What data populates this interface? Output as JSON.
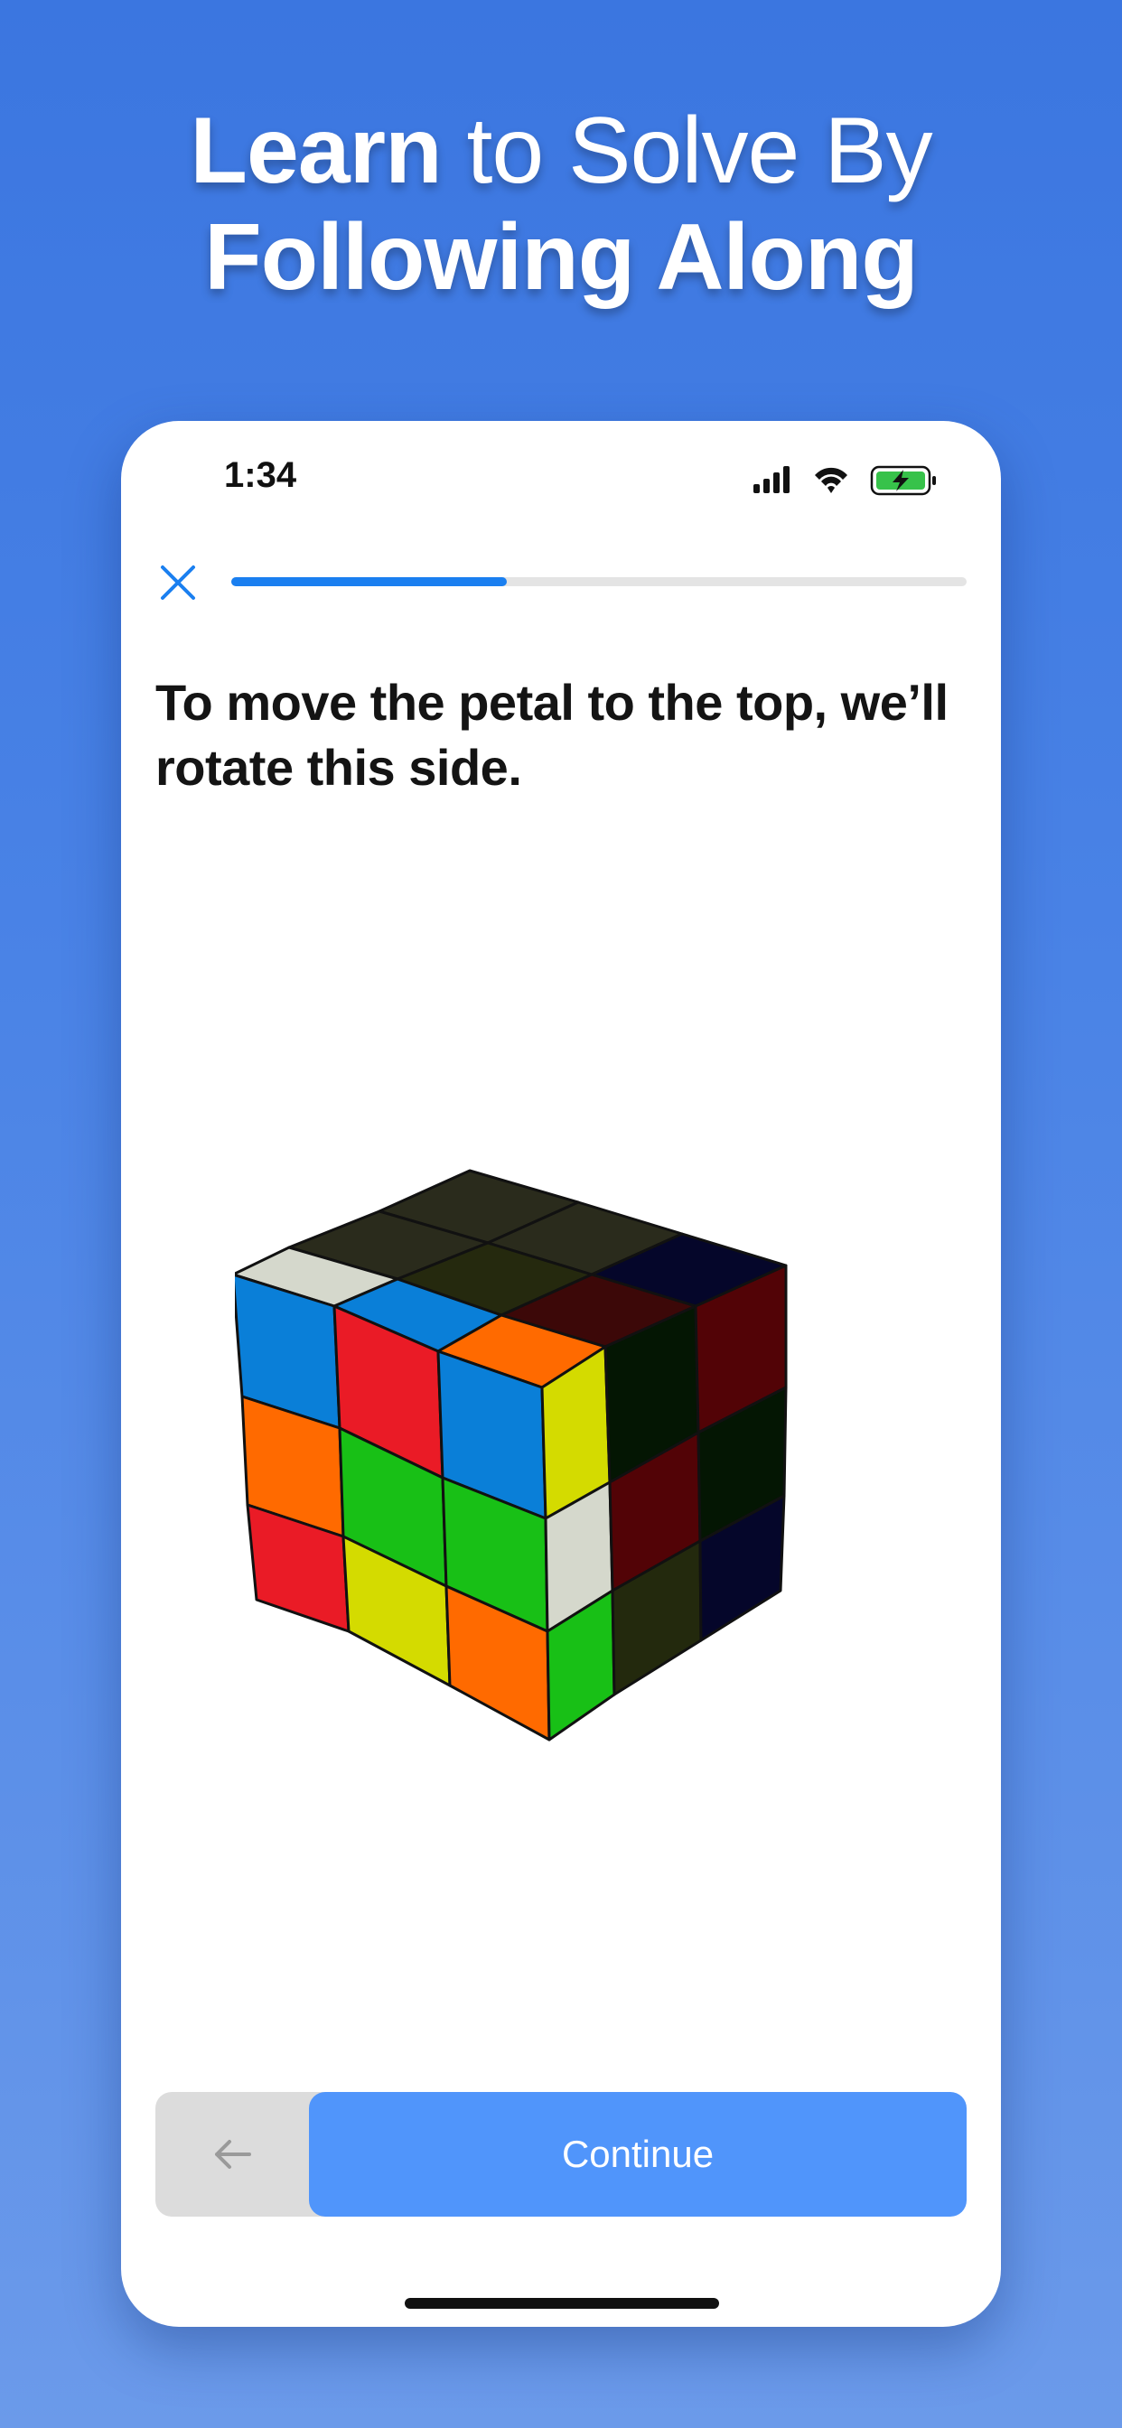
{
  "headline": {
    "line1_bold": "Learn",
    "line1_light": " to Solve By",
    "line2": "Following Along"
  },
  "status_bar": {
    "time": "1:34",
    "icons": [
      "cellular-signal-icon",
      "wifi-icon",
      "battery-charging-icon"
    ]
  },
  "progress": {
    "fraction": 0.375
  },
  "lesson": {
    "instruction": "To move the petal to the top, we’ll rotate this side."
  },
  "actions": {
    "continue_label": "Continue"
  },
  "colors": {
    "background": "#3b76e0",
    "accent": "#1a7ff0",
    "continue_button": "#5095fb"
  }
}
